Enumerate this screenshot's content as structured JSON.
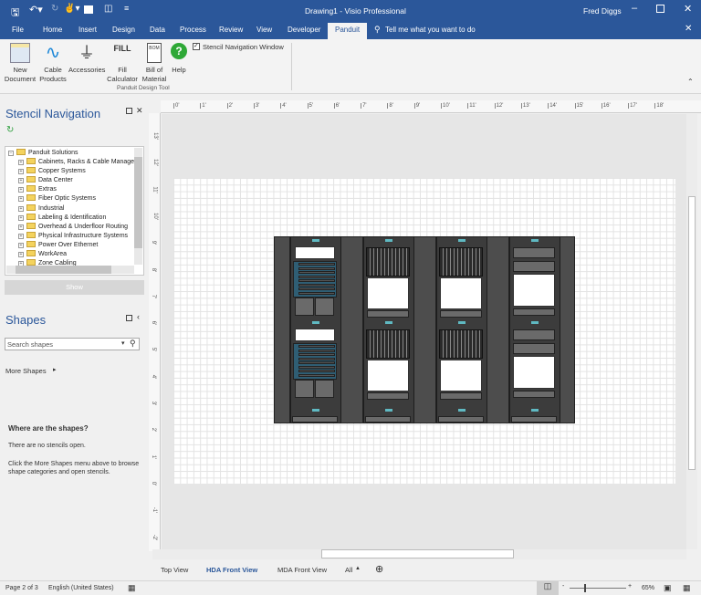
{
  "titlebar": {
    "title": "Drawing1  -  Visio Professional",
    "user": "Fred Diggs"
  },
  "tabs": [
    "File",
    "Home",
    "Insert",
    "Design",
    "Data",
    "Process",
    "Review",
    "View",
    "Developer",
    "Panduit"
  ],
  "tell_me": "Tell me what you want to do",
  "ribbon": {
    "buttons": [
      {
        "l1": "New",
        "l2": "Document"
      },
      {
        "l1": "Cable",
        "l2": "Products"
      },
      {
        "l1": "Accessories",
        "l2": ""
      },
      {
        "l1": "Fill",
        "l2": "Calculator"
      },
      {
        "l1": "Bill of",
        "l2": "Material"
      },
      {
        "l1": "Help",
        "l2": ""
      }
    ],
    "fill_icon_text": "FILL",
    "bom_icon_text": "BOM",
    "checkbox_label": "Stencil Navigation Window",
    "group_label": "Panduit Design Tool"
  },
  "stencil_nav": {
    "title": "Stencil Navigation",
    "root": "Panduit Solutions",
    "items": [
      "Cabinets, Racks & Cable Manager",
      "Copper Systems",
      "Data Center",
      "Extras",
      "Fiber Optic Systems",
      "Industrial",
      "Labeling & Identification",
      "Overhead & Underfloor Routing",
      "Physical Infrastructure Systems",
      "Power Over Ethernet",
      "WorkArea",
      "Zone Cabling"
    ],
    "show_button": "Show"
  },
  "shapes": {
    "title": "Shapes",
    "search_placeholder": "Search shapes",
    "more_shapes": "More Shapes",
    "where_title": "Where are the shapes?",
    "no_stencils": "There are no stencils open.",
    "hint": "Click the More Shapes menu above to browse shape categories and open stencils."
  },
  "ruler": {
    "top": [
      "0'",
      "1'",
      "2'",
      "3'",
      "4'",
      "5'",
      "6'",
      "7'",
      "8'",
      "9'",
      "10'",
      "11'",
      "12'",
      "13'",
      "14'",
      "15'",
      "16'",
      "17'",
      "18'"
    ],
    "left": [
      "13'",
      "12'",
      "11'",
      "10'",
      "9'",
      "8'",
      "7'",
      "6'",
      "5'",
      "4'",
      "3'",
      "2'",
      "1'",
      "0'",
      "-1'",
      "-2'"
    ]
  },
  "page_tabs": [
    "Top View",
    "HDA Front View",
    "MDA Front View",
    "All"
  ],
  "active_page_tab": "HDA Front View",
  "status": {
    "page": "Page 2 of 3",
    "language": "English (United States)",
    "zoom": "65%"
  },
  "colors": {
    "accent": "#2b579a",
    "active_tab_text": "#2b579a"
  }
}
